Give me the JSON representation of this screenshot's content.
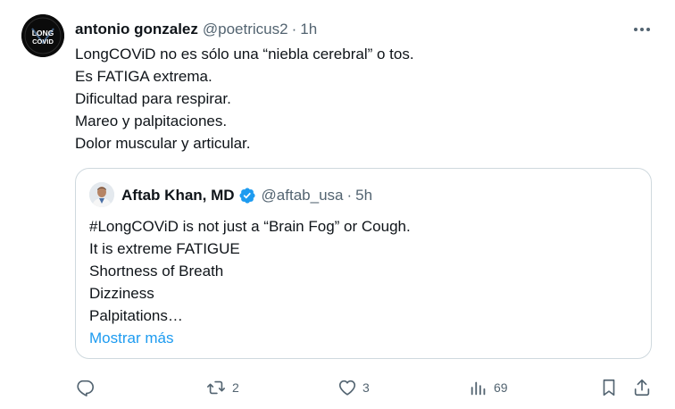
{
  "tweet": {
    "author_name": "antonio gonzalez",
    "handle": "@poetricus2",
    "separator": "·",
    "time": "1h",
    "avatar_text_top": "LONG",
    "avatar_text_bottom": "COVID",
    "lines": [
      "LongCOViD no es sólo una “niebla cerebral” o tos.",
      "Es FATIGA extrema.",
      "Dificultad para respirar.",
      "Mareo y palpitaciones.",
      "Dolor muscular y articular."
    ]
  },
  "quoted": {
    "author_name": "Aftab Khan, MD",
    "handle": "@aftab_usa",
    "separator": "·",
    "time": "5h",
    "verified_color": "#1d9bf0",
    "lines": [
      "#LongCOViD is not just a “Brain Fog” or Cough.",
      "It is extreme FATIGUE",
      "Shortness of Breath",
      "Dizziness",
      "Palpitations…"
    ],
    "show_more": "Mostrar más"
  },
  "actions": {
    "reply_icon": "reply-icon",
    "retweet_icon": "retweet-icon",
    "retweet_count": "2",
    "like_icon": "heart-icon",
    "like_count": "3",
    "views_icon": "views-icon",
    "views_count": "69",
    "bookmark_icon": "bookmark-icon",
    "share_icon": "share-icon"
  },
  "colors": {
    "text": "#0f1419",
    "secondary": "#536471",
    "link": "#1d9bf0",
    "border": "#cfd9de"
  }
}
